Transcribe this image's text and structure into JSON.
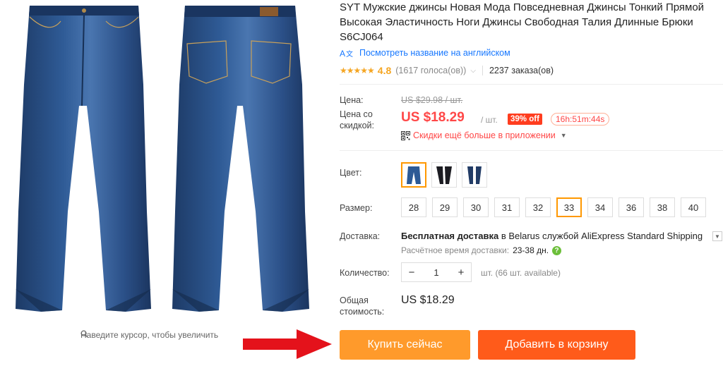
{
  "gallery": {
    "zoom_hint": "Наведите курсор, чтобы увеличить"
  },
  "product": {
    "title": "SYT Мужские джинсы Новая Мода Повседневная Джинсы Тонкий Прямой Высокая Эластичность Ноги Джинсы Свободная Талия Длинные Брюки S6CJ064",
    "translate_link": "Посмотреть название на английском",
    "rating_stars": "★★★★★",
    "rating": "4.8",
    "votes": "(1617 голоса(ов))",
    "orders": "2237 заказа(ов)"
  },
  "price": {
    "label": "Цена:",
    "old": "US $29.98 / шт.",
    "sale_label": "Цена со скидкой:",
    "sale": "US $18.29",
    "per_unit": "/ шт.",
    "discount": "39% off",
    "timer": "16h:51m:44s",
    "app_promo": "Скидки ещё больше в приложении"
  },
  "color": {
    "label": "Цвет:",
    "options": [
      "dark-blue-jeans",
      "black-jeans",
      "navy-jeans"
    ],
    "selected_index": 0
  },
  "size": {
    "label": "Размер:",
    "options": [
      "28",
      "29",
      "30",
      "31",
      "32",
      "33",
      "34",
      "36",
      "38",
      "40"
    ],
    "selected": "33"
  },
  "shipping": {
    "label": "Доставка:",
    "free_text": "Бесплатная доставка",
    "to_text": " в Belarus службой AliExpress Standard Shipping",
    "time_label": "Расчётное время доставки:",
    "time_value": "23-38 дн.",
    "help": "?"
  },
  "quantity": {
    "label": "Количество:",
    "minus": "−",
    "value": "1",
    "plus": "+",
    "available": "шт. (66 шт. available)"
  },
  "total": {
    "label": "Общая стоимость:",
    "value": "US $18.29"
  },
  "buttons": {
    "buy_now": "Купить сейчас",
    "add_to_cart": "Добавить в корзину"
  },
  "colors": {
    "price_red": "#ff4747",
    "buy_orange": "#ff9a2b",
    "cart_orange": "#ff5b1a",
    "link_blue": "#1677ff",
    "selected_border": "#ff9800",
    "arrow_red": "#e4121b"
  }
}
